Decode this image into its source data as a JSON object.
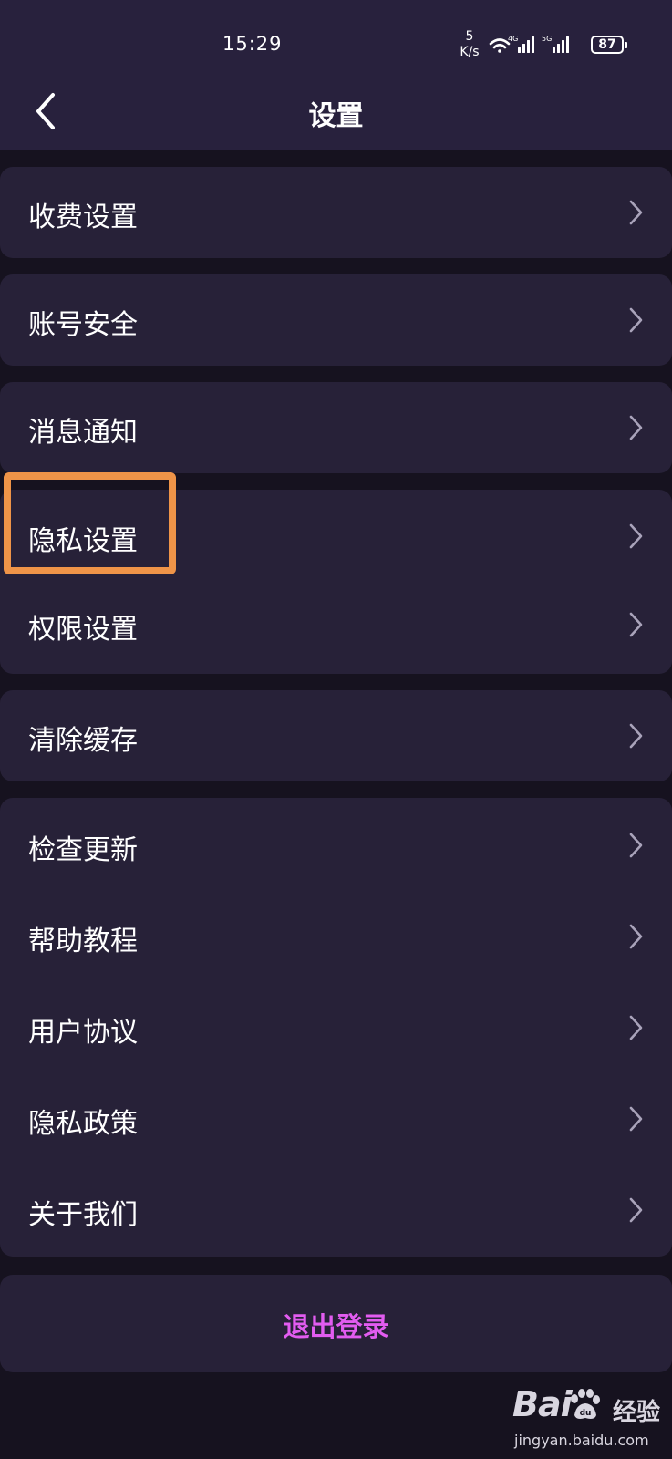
{
  "status_bar": {
    "time": "15:29",
    "net_speed_value": "5",
    "net_speed_unit": "K/s",
    "battery_level": "87",
    "network_labels": [
      "4G",
      "5G"
    ]
  },
  "header": {
    "title": "设置",
    "back_icon": "chevron-left-icon"
  },
  "settings_groups": [
    {
      "items": [
        "收费设置"
      ]
    },
    {
      "items": [
        "账号安全"
      ]
    },
    {
      "items": [
        "消息通知"
      ]
    },
    {
      "items": [
        "隐私设置",
        "权限设置"
      ]
    },
    {
      "items": [
        "清除缓存"
      ]
    },
    {
      "items": [
        "检查更新",
        "帮助教程",
        "用户协议",
        "隐私政策",
        "关于我们"
      ]
    }
  ],
  "highlighted_item": "隐私设置",
  "logout": {
    "label": "退出登录"
  },
  "watermark": {
    "brand": "Bai",
    "brand_suffix": "经验",
    "url": "jingyan.baidu.com"
  },
  "colors": {
    "background": "#16121f",
    "bar": "#28213d",
    "card": "#272138",
    "highlight": "#ef9448",
    "logout": "#e25cf0"
  }
}
